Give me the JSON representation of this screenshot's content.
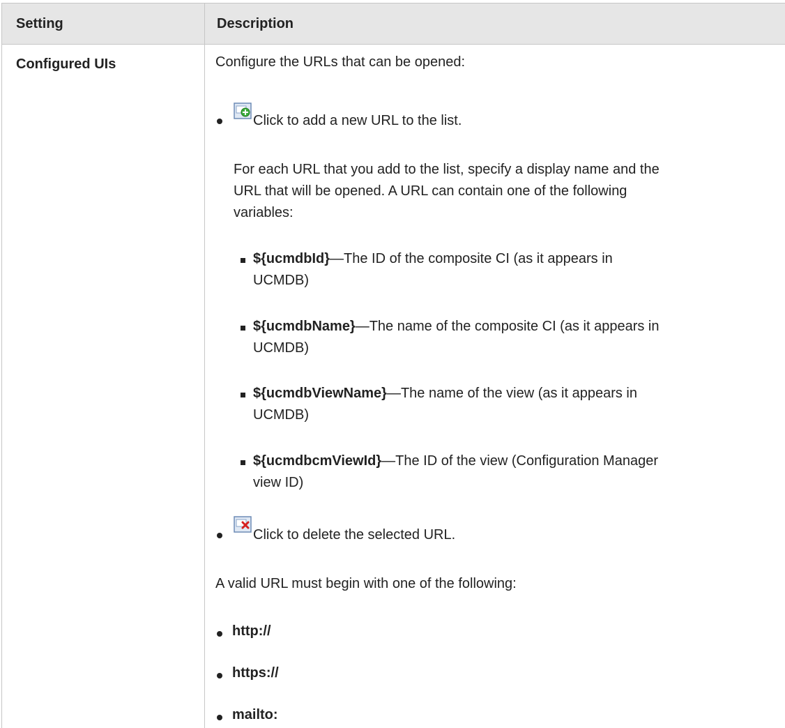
{
  "header": {
    "col1": "Setting",
    "col2": "Description"
  },
  "row": {
    "setting": "Configured UIs",
    "intro": "Configure the URLs that can be opened:",
    "add": {
      "icon": "add-url-icon",
      "text": "Click to add a new URL to the list."
    },
    "add_detail": [
      "For each URL that you add to the list, specify a display name and the",
      "URL that will be opened. A URL can contain one of the following",
      "variables:"
    ],
    "variables": [
      {
        "name": "${ucmdbId}",
        "desc_line1": "—The ID of the composite CI (as it appears in",
        "desc_line2": "UCMDB)"
      },
      {
        "name": "${ucmdbName}",
        "desc_line1": "—The name of the composite CI (as it appears in",
        "desc_line2": "UCMDB)"
      },
      {
        "name": "${ucmdbViewName}",
        "desc_line1": "—The name of the view (as it appears in",
        "desc_line2": "UCMDB)"
      },
      {
        "name": "${ucmdbcmViewId}",
        "desc_line1": "—The ID of the view (Configuration Manager",
        "desc_line2": "view ID)"
      }
    ],
    "delete": {
      "icon": "delete-url-icon",
      "text": "Click to delete the selected URL."
    },
    "valid_intro": "A valid URL must begin with one of the following:",
    "prefixes": [
      "http://",
      "https://",
      "mailto:"
    ]
  }
}
